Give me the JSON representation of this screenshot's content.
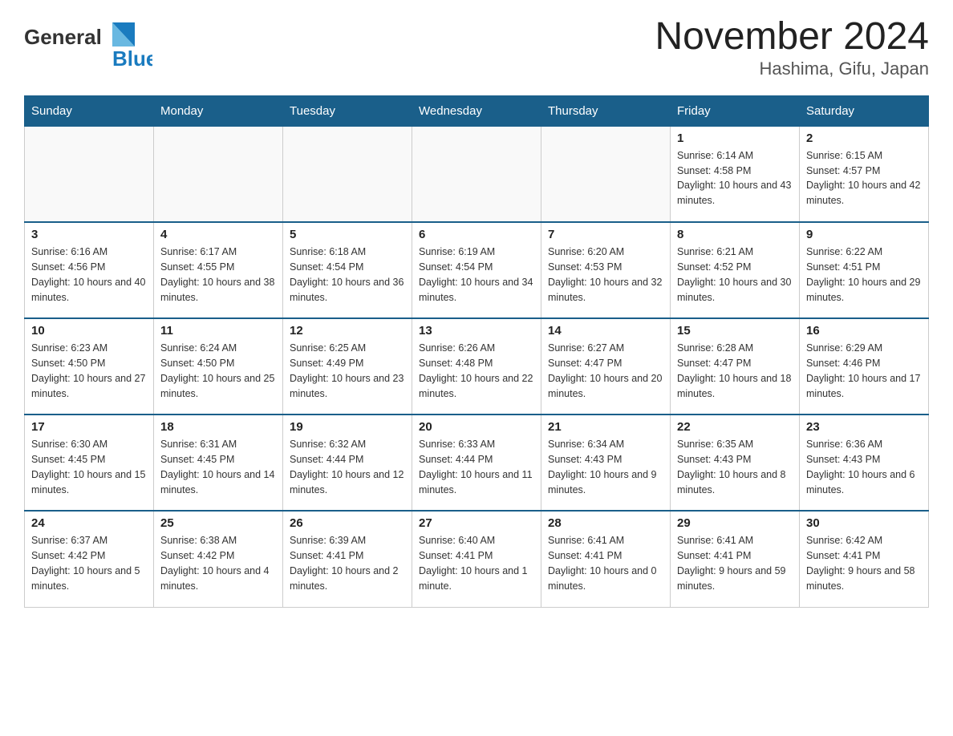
{
  "logo": {
    "text_general": "General",
    "text_blue": "Blue"
  },
  "title": "November 2024",
  "subtitle": "Hashima, Gifu, Japan",
  "days_of_week": [
    "Sunday",
    "Monday",
    "Tuesday",
    "Wednesday",
    "Thursday",
    "Friday",
    "Saturday"
  ],
  "weeks": [
    [
      {
        "day": "",
        "info": ""
      },
      {
        "day": "",
        "info": ""
      },
      {
        "day": "",
        "info": ""
      },
      {
        "day": "",
        "info": ""
      },
      {
        "day": "",
        "info": ""
      },
      {
        "day": "1",
        "info": "Sunrise: 6:14 AM\nSunset: 4:58 PM\nDaylight: 10 hours and 43 minutes."
      },
      {
        "day": "2",
        "info": "Sunrise: 6:15 AM\nSunset: 4:57 PM\nDaylight: 10 hours and 42 minutes."
      }
    ],
    [
      {
        "day": "3",
        "info": "Sunrise: 6:16 AM\nSunset: 4:56 PM\nDaylight: 10 hours and 40 minutes."
      },
      {
        "day": "4",
        "info": "Sunrise: 6:17 AM\nSunset: 4:55 PM\nDaylight: 10 hours and 38 minutes."
      },
      {
        "day": "5",
        "info": "Sunrise: 6:18 AM\nSunset: 4:54 PM\nDaylight: 10 hours and 36 minutes."
      },
      {
        "day": "6",
        "info": "Sunrise: 6:19 AM\nSunset: 4:54 PM\nDaylight: 10 hours and 34 minutes."
      },
      {
        "day": "7",
        "info": "Sunrise: 6:20 AM\nSunset: 4:53 PM\nDaylight: 10 hours and 32 minutes."
      },
      {
        "day": "8",
        "info": "Sunrise: 6:21 AM\nSunset: 4:52 PM\nDaylight: 10 hours and 30 minutes."
      },
      {
        "day": "9",
        "info": "Sunrise: 6:22 AM\nSunset: 4:51 PM\nDaylight: 10 hours and 29 minutes."
      }
    ],
    [
      {
        "day": "10",
        "info": "Sunrise: 6:23 AM\nSunset: 4:50 PM\nDaylight: 10 hours and 27 minutes."
      },
      {
        "day": "11",
        "info": "Sunrise: 6:24 AM\nSunset: 4:50 PM\nDaylight: 10 hours and 25 minutes."
      },
      {
        "day": "12",
        "info": "Sunrise: 6:25 AM\nSunset: 4:49 PM\nDaylight: 10 hours and 23 minutes."
      },
      {
        "day": "13",
        "info": "Sunrise: 6:26 AM\nSunset: 4:48 PM\nDaylight: 10 hours and 22 minutes."
      },
      {
        "day": "14",
        "info": "Sunrise: 6:27 AM\nSunset: 4:47 PM\nDaylight: 10 hours and 20 minutes."
      },
      {
        "day": "15",
        "info": "Sunrise: 6:28 AM\nSunset: 4:47 PM\nDaylight: 10 hours and 18 minutes."
      },
      {
        "day": "16",
        "info": "Sunrise: 6:29 AM\nSunset: 4:46 PM\nDaylight: 10 hours and 17 minutes."
      }
    ],
    [
      {
        "day": "17",
        "info": "Sunrise: 6:30 AM\nSunset: 4:45 PM\nDaylight: 10 hours and 15 minutes."
      },
      {
        "day": "18",
        "info": "Sunrise: 6:31 AM\nSunset: 4:45 PM\nDaylight: 10 hours and 14 minutes."
      },
      {
        "day": "19",
        "info": "Sunrise: 6:32 AM\nSunset: 4:44 PM\nDaylight: 10 hours and 12 minutes."
      },
      {
        "day": "20",
        "info": "Sunrise: 6:33 AM\nSunset: 4:44 PM\nDaylight: 10 hours and 11 minutes."
      },
      {
        "day": "21",
        "info": "Sunrise: 6:34 AM\nSunset: 4:43 PM\nDaylight: 10 hours and 9 minutes."
      },
      {
        "day": "22",
        "info": "Sunrise: 6:35 AM\nSunset: 4:43 PM\nDaylight: 10 hours and 8 minutes."
      },
      {
        "day": "23",
        "info": "Sunrise: 6:36 AM\nSunset: 4:43 PM\nDaylight: 10 hours and 6 minutes."
      }
    ],
    [
      {
        "day": "24",
        "info": "Sunrise: 6:37 AM\nSunset: 4:42 PM\nDaylight: 10 hours and 5 minutes."
      },
      {
        "day": "25",
        "info": "Sunrise: 6:38 AM\nSunset: 4:42 PM\nDaylight: 10 hours and 4 minutes."
      },
      {
        "day": "26",
        "info": "Sunrise: 6:39 AM\nSunset: 4:41 PM\nDaylight: 10 hours and 2 minutes."
      },
      {
        "day": "27",
        "info": "Sunrise: 6:40 AM\nSunset: 4:41 PM\nDaylight: 10 hours and 1 minute."
      },
      {
        "day": "28",
        "info": "Sunrise: 6:41 AM\nSunset: 4:41 PM\nDaylight: 10 hours and 0 minutes."
      },
      {
        "day": "29",
        "info": "Sunrise: 6:41 AM\nSunset: 4:41 PM\nDaylight: 9 hours and 59 minutes."
      },
      {
        "day": "30",
        "info": "Sunrise: 6:42 AM\nSunset: 4:41 PM\nDaylight: 9 hours and 58 minutes."
      }
    ]
  ]
}
